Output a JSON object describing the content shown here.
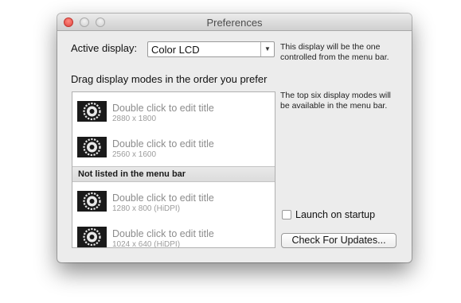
{
  "window": {
    "title": "Preferences"
  },
  "active_display": {
    "label": "Active display:",
    "selected": "Color LCD"
  },
  "descriptions": {
    "display_note": "This display will be the one controlled from the menu bar.",
    "top_six_note": "The top six display modes will be available in the menu bar."
  },
  "modes": {
    "instruction": "Drag display modes in the order you prefer",
    "listed": [
      {
        "title": "Double click to edit title",
        "resolution": "2880 x 1800"
      },
      {
        "title": "Double click to edit title",
        "resolution": "2560 x 1600"
      }
    ],
    "section_header": "Not listed in the menu bar",
    "unlisted": [
      {
        "title": "Double click to edit title",
        "resolution": "1280 x 800 (HiDPI)"
      },
      {
        "title": "Double click to edit title",
        "resolution": "1024 x 640 (HiDPI)"
      }
    ]
  },
  "launch_on_startup": {
    "label": "Launch on startup",
    "checked": false
  },
  "updates_button": {
    "label": "Check For Updates..."
  }
}
